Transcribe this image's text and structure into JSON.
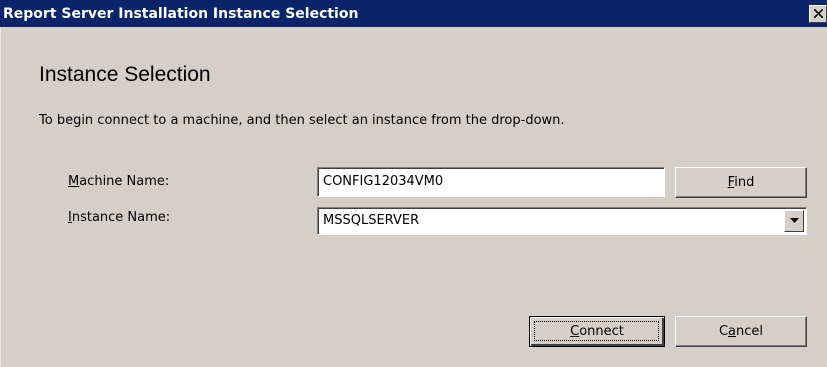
{
  "window": {
    "title": "Report Server Installation Instance Selection",
    "close_icon": "close-x-icon"
  },
  "main": {
    "heading": "Instance Selection",
    "instructions": "To begin connect to a machine, and then select an instance from the drop-down."
  },
  "machine": {
    "label_accel": "M",
    "label_rest": "achine Name:",
    "value": "CONFIG12034VM0",
    "find_accel": "F",
    "find_rest": "ind"
  },
  "instance": {
    "label_accel": "I",
    "label_rest": "nstance Name:",
    "selected": "MSSQLSERVER",
    "dropdown_icon": "chevron-down-icon"
  },
  "buttons": {
    "connect_accel": "C",
    "connect_rest": "onnect",
    "cancel_pre": "C",
    "cancel_accel": "a",
    "cancel_rest": "ncel"
  },
  "colors": {
    "titlebar": "#0a246a",
    "face": "#d4d0c8",
    "field": "#ffffff"
  }
}
